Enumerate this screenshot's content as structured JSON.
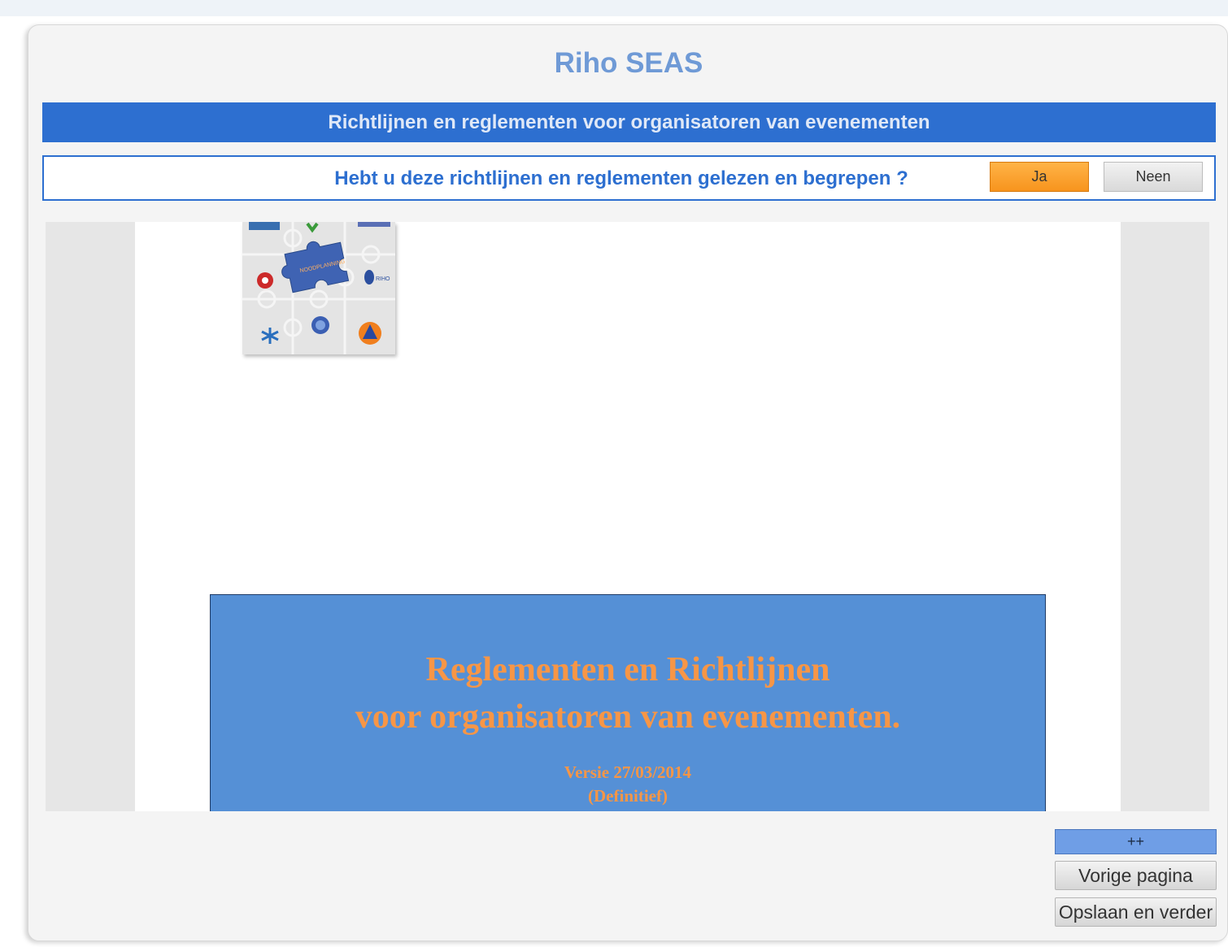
{
  "app": {
    "title": "Riho SEAS"
  },
  "banner": {
    "text": "Richtlijnen en reglementen voor organisatoren van evenementen"
  },
  "question": {
    "text": "Hebt u deze richtlijnen en reglementen gelezen en begrepen ?",
    "yes_label": "Ja",
    "no_label": "Neen",
    "colors": {
      "yes": "#f7941d",
      "no": "#d9d9d9",
      "accent": "#2d6fd0"
    }
  },
  "document": {
    "slide": {
      "line1": "Reglementen en Richtlijnen",
      "line2": "voor organisatoren van evenementen.",
      "version": "Versie 27/03/2014",
      "status": "(Definitief)"
    },
    "thumbnail": {
      "puzzle_label": "NOODPLANNING",
      "logo_label": "RIHO"
    }
  },
  "actions": {
    "expand_label": "++",
    "prev_label": "Vorige pagina",
    "next_label": "Opslaan en verder"
  }
}
